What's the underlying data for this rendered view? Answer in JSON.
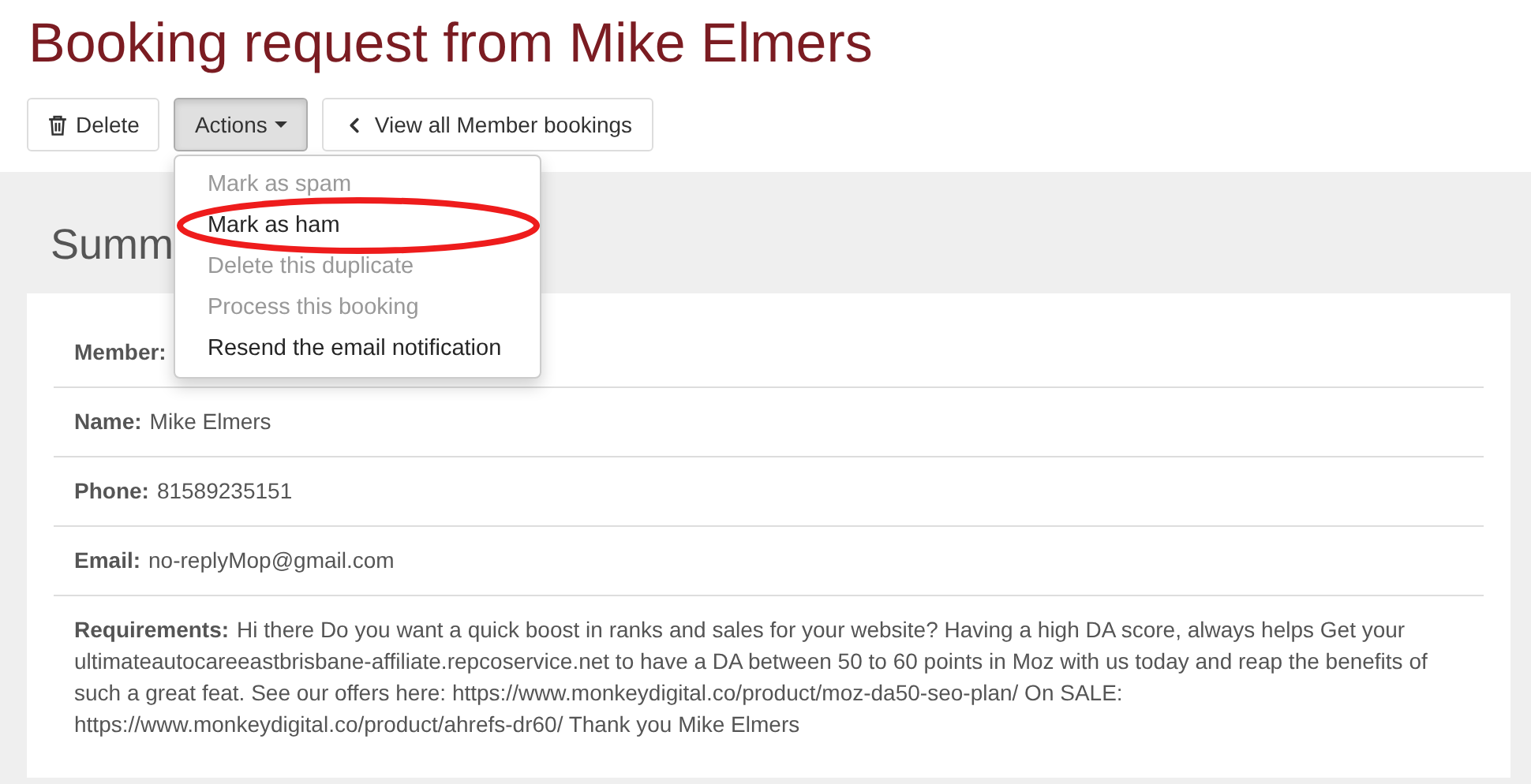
{
  "title": "Booking request from Mike Elmers",
  "toolbar": {
    "delete": "Delete",
    "actions": {
      "label": "Actions",
      "expanded": true
    },
    "back": "View all Member bookings"
  },
  "actions_menu": [
    {
      "label": "Mark as spam",
      "disabled": true,
      "circled": false
    },
    {
      "label": "Mark as ham",
      "disabled": false,
      "circled": true
    },
    {
      "label": "Delete this duplicate",
      "disabled": true,
      "circled": false
    },
    {
      "label": "Process this booking",
      "disabled": true,
      "circled": false
    },
    {
      "label": "Resend the email notification",
      "disabled": false,
      "circled": false
    }
  ],
  "summary": {
    "heading": "Summ",
    "fields": [
      {
        "label": "Member:"
      },
      {
        "label": "Name:",
        "value": "Mike Elmers"
      },
      {
        "label": "Phone:",
        "value": "81589235151"
      },
      {
        "label": "Email:",
        "value": "no-replyMop@gmail.com"
      },
      {
        "label": "Requirements:",
        "value": "Hi there Do you want a quick boost in ranks and sales for your website? Having a high DA score, always helps Get your ultimateautocareeastbrisbane-affiliate.repcoservice.net to have a DA between 50 to 60 points in Moz with us today and reap the benefits of such a great feat. See our offers here: https://www.monkeydigital.co/product/moz-da50-seo-plan/ On SALE: https://www.monkeydigital.co/product/ahrefs-dr60/ Thank you Mike Elmers"
      }
    ]
  }
}
